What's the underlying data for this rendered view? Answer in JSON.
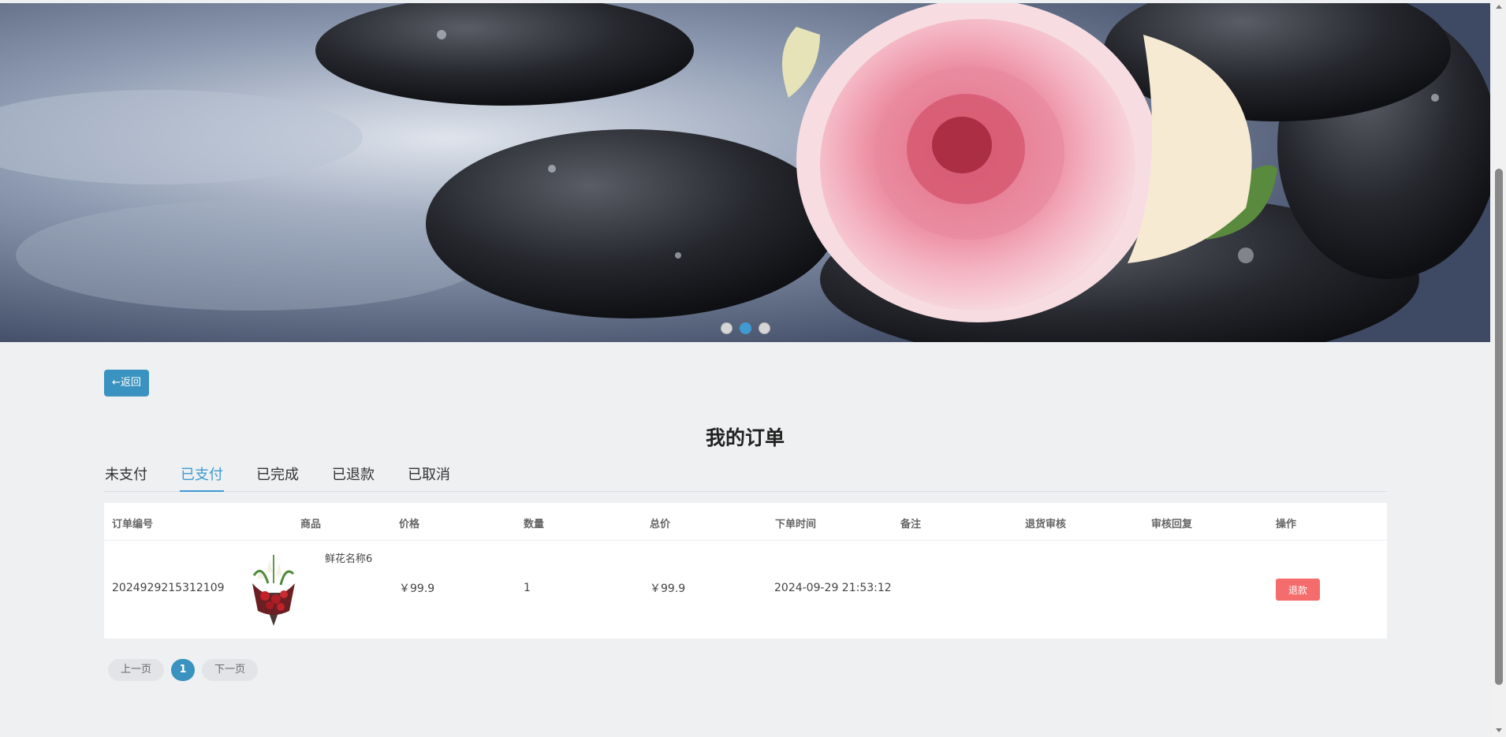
{
  "banner": {
    "dots": [
      {
        "active": false
      },
      {
        "active": true
      },
      {
        "active": false
      }
    ]
  },
  "back_button": {
    "label": "←返回"
  },
  "page_title": "我的订单",
  "tabs": [
    {
      "label": "未支付"
    },
    {
      "label": "已支付"
    },
    {
      "label": "已完成"
    },
    {
      "label": "已退款"
    },
    {
      "label": "已取消"
    }
  ],
  "active_tab": "已支付",
  "table": {
    "headers": [
      "订单编号",
      "商品",
      "价格",
      "数量",
      "总价",
      "下单时间",
      "备注",
      "退货审核",
      "审核回复",
      "操作"
    ],
    "rows": [
      {
        "order_no": "2024929215312109",
        "product_name": "鲜花名称6",
        "price": "￥99.9",
        "quantity": "1",
        "total": "￥99.9",
        "order_time": "2024-09-29 21:53:12",
        "remark": "",
        "refund_review": "",
        "review_reply": "",
        "action_label": "退款"
      }
    ]
  },
  "pagination": {
    "prev_label": "上一页",
    "current_page": "1",
    "next_label": "下一页"
  },
  "colors": {
    "accent": "#3992bf",
    "tab_active": "#3f9bd1",
    "danger": "#f56c6c",
    "background": "#eef0f2"
  }
}
